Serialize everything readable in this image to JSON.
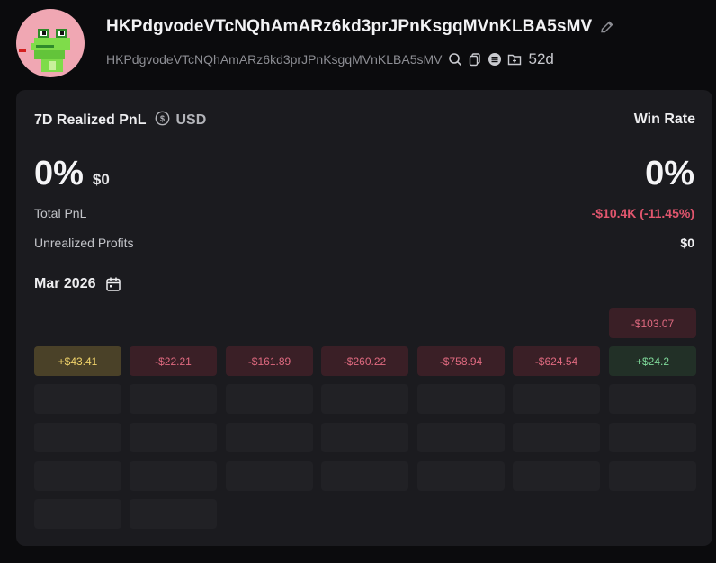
{
  "wallet": {
    "title": "HKPdgvodeVTcNQhAmARz6kd3prJPnKsgqMVnKLBA5sMV",
    "address": "HKPdgvodeVTcNQhAmARz6kd3prJPnKsgqMVnKLBA5sMV",
    "age": "52d"
  },
  "card": {
    "pnl_title": "7D Realized PnL",
    "currency": "USD",
    "win_rate_title": "Win Rate",
    "realized_pct": "0%",
    "realized_usd": "$0",
    "win_rate_value": "0%",
    "total_pnl_label": "Total PnL",
    "total_pnl_value": "-$10.4K (-11.45%)",
    "unrealized_label": "Unrealized Profits",
    "unrealized_value": "$0",
    "month_label": "Mar 2026"
  },
  "calendar": {
    "cells": [
      {
        "value": "-$103.07",
        "kind": "neg"
      },
      {
        "value": "+$43.41",
        "kind": "pos-yellow"
      },
      {
        "value": "-$22.21",
        "kind": "neg"
      },
      {
        "value": "-$161.89",
        "kind": "neg"
      },
      {
        "value": "-$260.22",
        "kind": "neg"
      },
      {
        "value": "-$758.94",
        "kind": "neg"
      },
      {
        "value": "-$624.54",
        "kind": "neg"
      },
      {
        "value": "+$24.2",
        "kind": "pos-green"
      }
    ]
  },
  "colors": {
    "negative": "#e2566e",
    "positive": "#7fd99a",
    "avatar_bg": "#f0a7b3"
  },
  "icons": [
    "edit-icon",
    "search-icon",
    "copy-icon",
    "coin-icon",
    "folder-icon",
    "currency-swap-icon",
    "calendar-icon"
  ]
}
